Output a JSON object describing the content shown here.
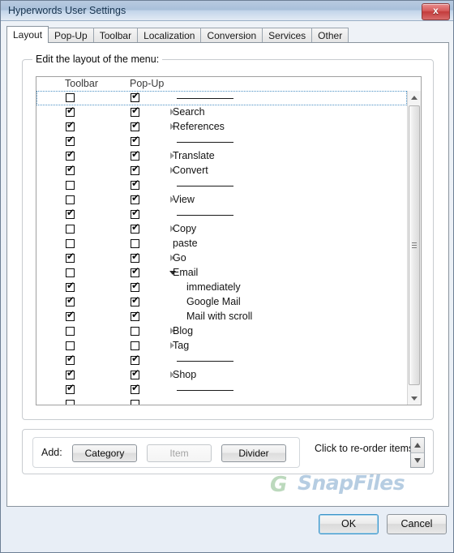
{
  "window": {
    "title": "Hyperwords User Settings",
    "close_icon": "close-icon",
    "close_label": "x"
  },
  "tabs": [
    {
      "label": "Layout",
      "active": true
    },
    {
      "label": "Pop-Up",
      "active": false
    },
    {
      "label": "Toolbar",
      "active": false
    },
    {
      "label": "Localization",
      "active": false
    },
    {
      "label": "Conversion",
      "active": false
    },
    {
      "label": "Services",
      "active": false
    },
    {
      "label": "Other",
      "active": false
    }
  ],
  "group": {
    "legend": "Edit the layout of the menu:",
    "columns": {
      "toolbar": "Toolbar",
      "popup": "Pop-Up"
    }
  },
  "list": {
    "rows": [
      {
        "toolbar": false,
        "popup": true,
        "type": "divider",
        "label": "",
        "focused": true
      },
      {
        "toolbar": true,
        "popup": true,
        "type": "category",
        "label": "Search",
        "focused": false
      },
      {
        "toolbar": true,
        "popup": true,
        "type": "category",
        "label": "References",
        "focused": false
      },
      {
        "toolbar": true,
        "popup": true,
        "type": "divider",
        "label": "",
        "focused": false
      },
      {
        "toolbar": true,
        "popup": true,
        "type": "category",
        "label": "Translate",
        "focused": false
      },
      {
        "toolbar": true,
        "popup": true,
        "type": "category",
        "label": "Convert",
        "focused": false
      },
      {
        "toolbar": false,
        "popup": true,
        "type": "divider",
        "label": "",
        "focused": false
      },
      {
        "toolbar": false,
        "popup": true,
        "type": "category",
        "label": "View",
        "focused": false
      },
      {
        "toolbar": true,
        "popup": true,
        "type": "divider",
        "label": "",
        "focused": false
      },
      {
        "toolbar": false,
        "popup": true,
        "type": "category",
        "label": "Copy",
        "focused": false
      },
      {
        "toolbar": false,
        "popup": false,
        "type": "item",
        "label": "paste",
        "focused": false
      },
      {
        "toolbar": true,
        "popup": true,
        "type": "category",
        "label": "Go",
        "focused": false
      },
      {
        "toolbar": false,
        "popup": true,
        "type": "expanded",
        "label": "Email",
        "focused": false
      },
      {
        "toolbar": true,
        "popup": true,
        "type": "child",
        "label": "immediately",
        "focused": false
      },
      {
        "toolbar": true,
        "popup": true,
        "type": "child",
        "label": "Google Mail",
        "focused": false
      },
      {
        "toolbar": true,
        "popup": true,
        "type": "child",
        "label": "Mail with scroll",
        "focused": false
      },
      {
        "toolbar": false,
        "popup": false,
        "type": "category",
        "label": "Blog",
        "focused": false
      },
      {
        "toolbar": false,
        "popup": false,
        "type": "category",
        "label": "Tag",
        "focused": false
      },
      {
        "toolbar": true,
        "popup": true,
        "type": "divider",
        "label": "",
        "focused": false
      },
      {
        "toolbar": true,
        "popup": true,
        "type": "category",
        "label": "Shop",
        "focused": false
      },
      {
        "toolbar": true,
        "popup": true,
        "type": "divider",
        "label": "",
        "focused": false
      },
      {
        "toolbar": false,
        "popup": false,
        "type": "partial",
        "label": "",
        "focused": false
      }
    ],
    "check_glyph": "✔",
    "scrollbar": {
      "up_icon": "scroll-up-arrow-icon",
      "down_icon": "scroll-down-arrow-icon"
    }
  },
  "addbar": {
    "add_label": "Add:",
    "category_label": "Category",
    "item_label": "Item",
    "item_disabled": true,
    "divider_label": "Divider",
    "reorder_label": "Click to re-order items:",
    "up_icon": "reorder-up-arrow-icon",
    "down_icon": "reorder-down-arrow-icon"
  },
  "watermark": {
    "text": "SnapFiles",
    "logo": "G"
  },
  "footer": {
    "ok_label": "OK",
    "cancel_label": "Cancel"
  },
  "colors": {
    "titlebar": "#b8cae0",
    "close_red": "#c33b3b",
    "accent_focus": "#3d94c8",
    "watermark": "#b6cde2"
  }
}
